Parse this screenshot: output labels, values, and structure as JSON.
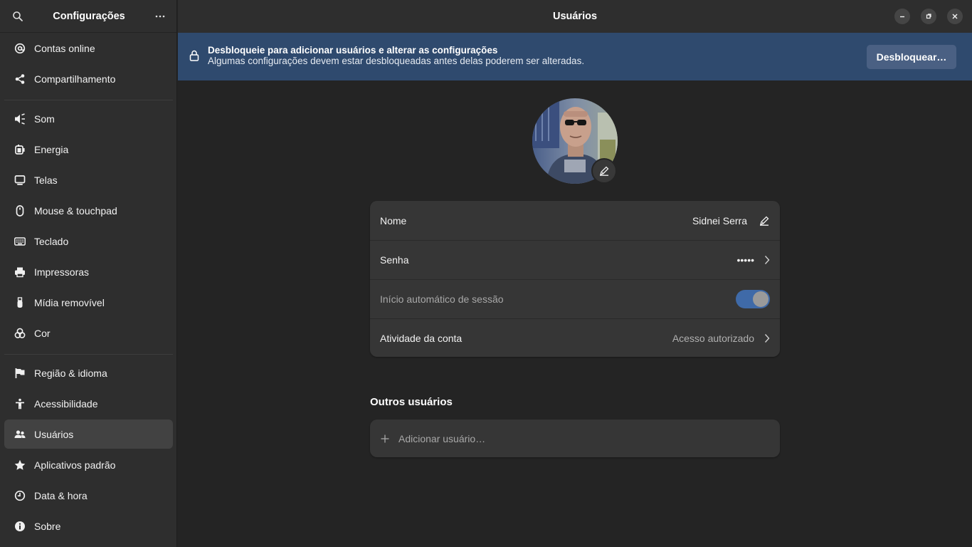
{
  "sidebar": {
    "title": "Configurações",
    "items": [
      {
        "label": "Contas online",
        "icon": "at-icon"
      },
      {
        "label": "Compartilhamento",
        "icon": "share-icon"
      },
      {
        "label": "Som",
        "icon": "speaker-icon"
      },
      {
        "label": "Energia",
        "icon": "battery-icon"
      },
      {
        "label": "Telas",
        "icon": "display-icon"
      },
      {
        "label": "Mouse & touchpad",
        "icon": "mouse-icon"
      },
      {
        "label": "Teclado",
        "icon": "keyboard-icon"
      },
      {
        "label": "Impressoras",
        "icon": "printer-icon"
      },
      {
        "label": "Mídia removível",
        "icon": "usb-icon"
      },
      {
        "label": "Cor",
        "icon": "color-icon"
      },
      {
        "label": "Região & idioma",
        "icon": "flag-icon"
      },
      {
        "label": "Acessibilidade",
        "icon": "accessibility-icon"
      },
      {
        "label": "Usuários",
        "icon": "users-icon",
        "active": true
      },
      {
        "label": "Aplicativos padrão",
        "icon": "star-icon"
      },
      {
        "label": "Data & hora",
        "icon": "clock-icon"
      },
      {
        "label": "Sobre",
        "icon": "info-icon"
      }
    ]
  },
  "header": {
    "title": "Usuários"
  },
  "banner": {
    "title": "Desbloqueie para adicionar usuários e alterar as configurações",
    "subtitle": "Algumas configurações devem estar desbloqueadas antes delas poderem ser alteradas.",
    "button_label": "Desbloquear…"
  },
  "user": {
    "rows": {
      "name_label": "Nome",
      "name_value": "Sidnei Serra",
      "password_label": "Senha",
      "password_value": "•••••",
      "autologin_label": "Início automático de sessão",
      "autologin_enabled": true,
      "activity_label": "Atividade da conta",
      "activity_value": "Acesso autorizado"
    }
  },
  "others": {
    "title": "Outros usuários",
    "add_label": "Adicionar usuário…"
  },
  "colors": {
    "banner": "#2f4a6e",
    "toggle_on": "#3f6aa8",
    "window_bg": "#242424",
    "sidebar_bg": "#2e2e2e"
  }
}
